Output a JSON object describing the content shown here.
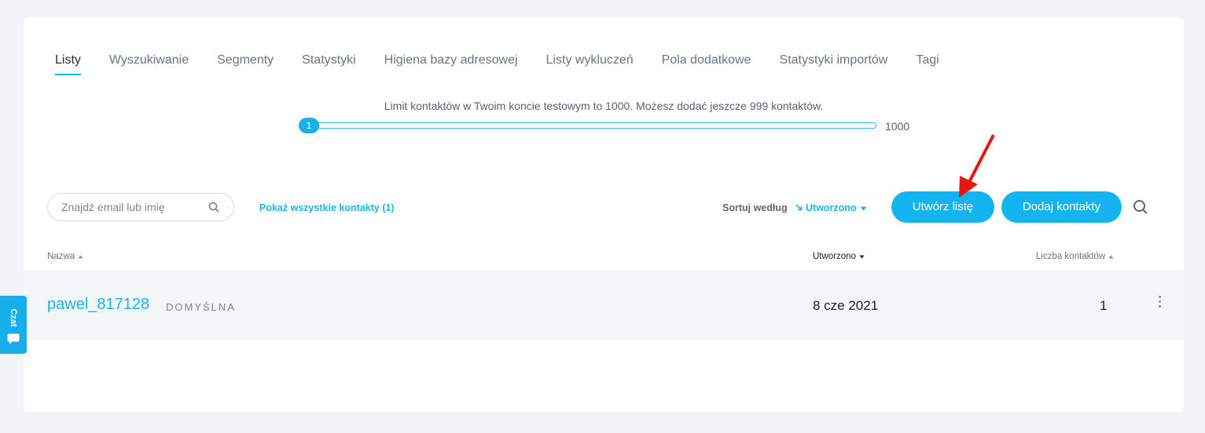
{
  "tabs": [
    {
      "label": "Listy",
      "active": true
    },
    {
      "label": "Wyszukiwanie"
    },
    {
      "label": "Segmenty"
    },
    {
      "label": "Statystyki"
    },
    {
      "label": "Higiena bazy adresowej"
    },
    {
      "label": "Listy wykluczeń"
    },
    {
      "label": "Pola dodatkowe"
    },
    {
      "label": "Statystyki importów"
    },
    {
      "label": "Tagi"
    }
  ],
  "limit": {
    "text": "Limit kontaktów w Twoim koncie testowym to 1000. Możesz dodać jeszcze 999 kontaktów.",
    "current": "1",
    "max": "1000"
  },
  "toolbar": {
    "search_placeholder": "Znajdź email lub imię",
    "show_all": "Pokaż wszystkie kontakty (1)",
    "sort_label": "Sortuj według",
    "sort_value": "Utworzono",
    "create_list": "Utwórz listę",
    "add_contacts": "Dodaj kontakty"
  },
  "table": {
    "columns": {
      "name": "Nazwa",
      "created": "Utworzono",
      "count": "Liczba kontaktów"
    },
    "rows": [
      {
        "name": "pawel_817128",
        "badge": "DOMYŚLNA",
        "created": "8 cze 2021",
        "count": "1"
      }
    ]
  },
  "chat": {
    "label": "Czat"
  },
  "colors": {
    "accent": "#14b4f0",
    "arrow": "#e8160f"
  }
}
